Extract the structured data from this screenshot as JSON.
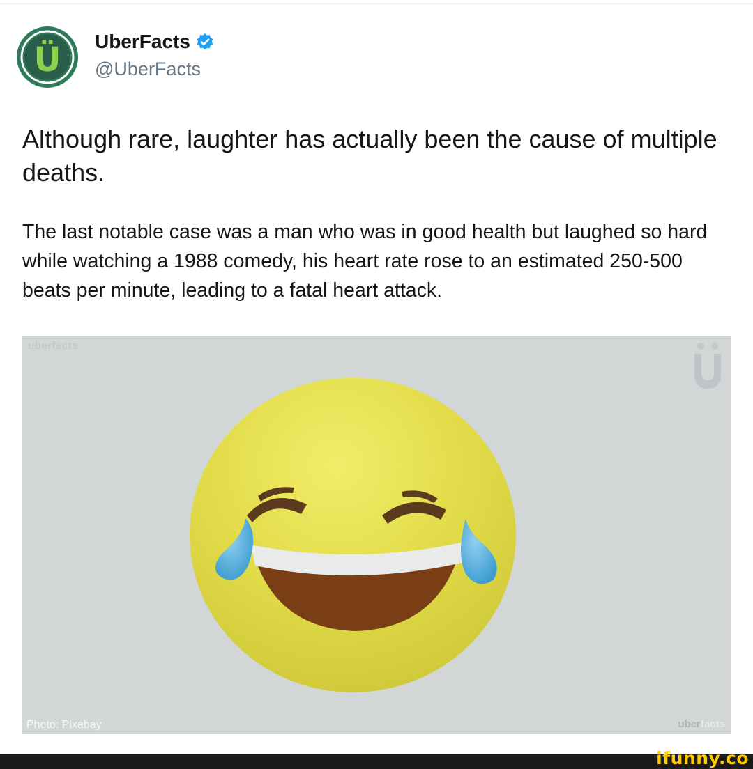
{
  "post": {
    "author_name": "UberFacts",
    "author_handle": "@UberFacts",
    "avatar_letter": "Ü",
    "headline": "Although rare, laughter has actually been the cause of multiple deaths.",
    "body": "The last notable case was a man who was in good health but laughed so hard while watching a 1988 comedy, his heart rate rose to an estimated 250-500 beats per minute, leading to a fatal heart attack."
  },
  "image": {
    "credit": "Photo: Pixabay",
    "watermark_top_left": "uberfacts",
    "watermark_logo": "Ü",
    "watermark_bottom_right_a": "uber",
    "watermark_bottom_right_b": "facts",
    "subject_icon": "tears-of-joy-emoji"
  },
  "footer": {
    "site_watermark": "ifunny.co"
  },
  "colors": {
    "brand_green": "#2e7a5a",
    "verified_blue": "#1da1f2",
    "photo_background": "#d2d6d7",
    "emoji_yellow": "#e3dd4a",
    "footer_accent": "#ffcc00"
  }
}
